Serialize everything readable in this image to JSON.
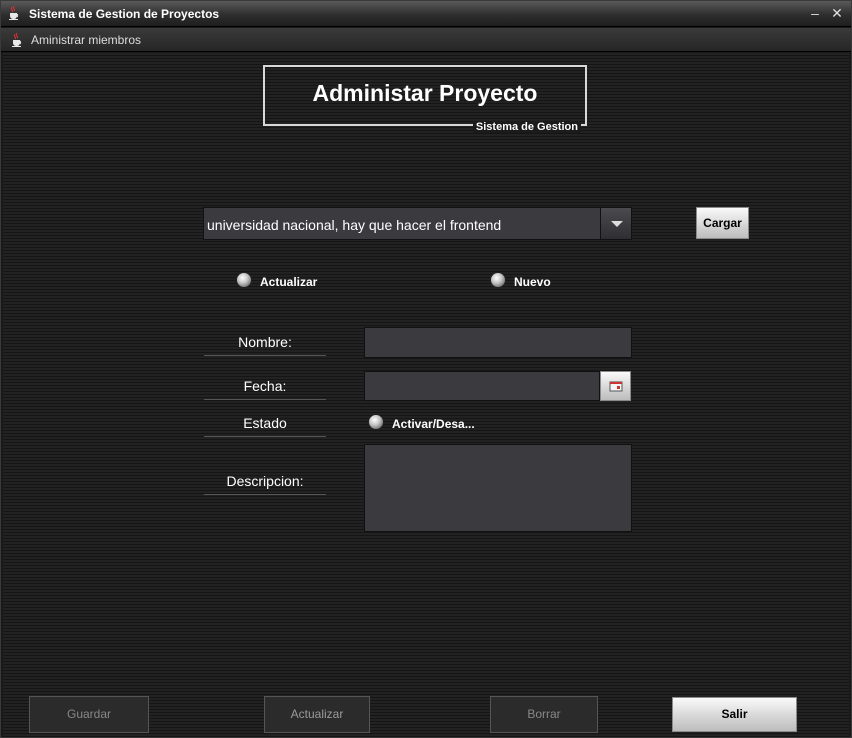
{
  "window": {
    "title": "Sistema de Gestion de Proyectos",
    "minimize_glyph": "–",
    "close_glyph": "✕"
  },
  "menubar": {
    "item_label": "Aministrar miembros"
  },
  "header": {
    "title": "Administar Proyecto",
    "subtitle": "Sistema de Gestion"
  },
  "project_select": {
    "selected": "universidad nacional, hay que hacer el frontend"
  },
  "load_button": {
    "label": "Cargar"
  },
  "mode_radios": {
    "update_label": "Actualizar",
    "new_label": "Nuevo"
  },
  "form": {
    "name_label": "Nombre:",
    "name_value": "",
    "date_label": "Fecha:",
    "date_value": "",
    "status_label": "Estado",
    "status_toggle_label": "Activar/Desa...",
    "description_label": "Descripcion:",
    "description_value": ""
  },
  "footer": {
    "save_label": "Guardar",
    "update_label": "Actualizar",
    "delete_label": "Borrar",
    "exit_label": "Salir"
  },
  "icons": {
    "app": "java-cup-icon",
    "menu": "java-cup-icon",
    "combo_arrow": "chevron-down-icon",
    "calendar": "calendar-icon"
  }
}
